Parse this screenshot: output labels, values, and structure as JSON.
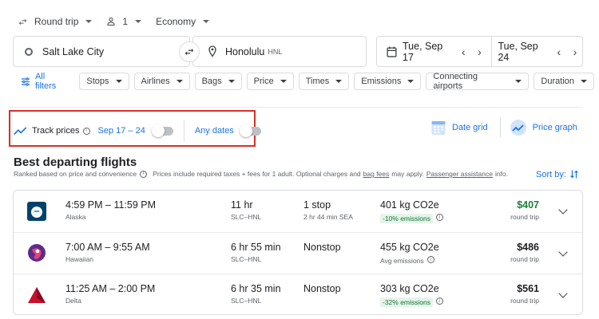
{
  "options": {
    "trip_type": "Round trip",
    "passengers": "1",
    "cabin": "Economy"
  },
  "search": {
    "origin": "Salt Lake City",
    "destination": "Honolulu",
    "destination_code": "HNL",
    "depart_date": "Tue, Sep 17",
    "return_date": "Tue, Sep 24"
  },
  "filters": {
    "all_filters": "All filters",
    "chips": [
      "Stops",
      "Airlines",
      "Bags",
      "Price",
      "Times",
      "Emissions",
      "Connecting airports",
      "Duration"
    ]
  },
  "track": {
    "label": "Track prices",
    "dates": "Sep 17 – 24",
    "any_dates": "Any dates",
    "date_grid": "Date grid",
    "price_graph": "Price graph"
  },
  "section": {
    "title": "Best departing flights",
    "ranked_note": "Ranked based on price and convenience",
    "prices_note": "Prices include required taxes + fees for 1 adult. Optional charges and",
    "bag_fees": "bag fees",
    "may_apply": "may apply.",
    "passenger_assistance": "Passenger assistance",
    "info_suffix": "info.",
    "sort_by": "Sort by:"
  },
  "flights": [
    {
      "times": "4:59 PM – 11:59 PM",
      "airline": "Alaska",
      "duration": "11 hr",
      "route": "SLC–HNL",
      "stops": "1 stop",
      "stop_detail": "2 hr 44 min SEA",
      "co2": "401 kg CO2e",
      "emissions": "-10% emissions",
      "price": "$407",
      "price_type": "round trip"
    },
    {
      "times": "7:00 AM – 9:55 AM",
      "airline": "Hawaiian",
      "duration": "6 hr 55 min",
      "route": "SLC–HNL",
      "stops": "Nonstop",
      "stop_detail": "",
      "co2": "455 kg CO2e",
      "emissions": "Avg emissions",
      "price": "$486",
      "price_type": "round trip"
    },
    {
      "times": "11:25 AM – 2:00 PM",
      "airline": "Delta",
      "duration": "6 hr 35 min",
      "route": "SLC–HNL",
      "stops": "Nonstop",
      "stop_detail": "",
      "co2": "303 kg CO2e",
      "emissions": "-32% emissions",
      "price": "$561",
      "price_type": "round trip"
    }
  ],
  "colors": {
    "accent": "#1a73e8",
    "good_price": "#188038",
    "highlight_border": "#d93025",
    "low_emissions_bg": "#e6f4ea"
  }
}
